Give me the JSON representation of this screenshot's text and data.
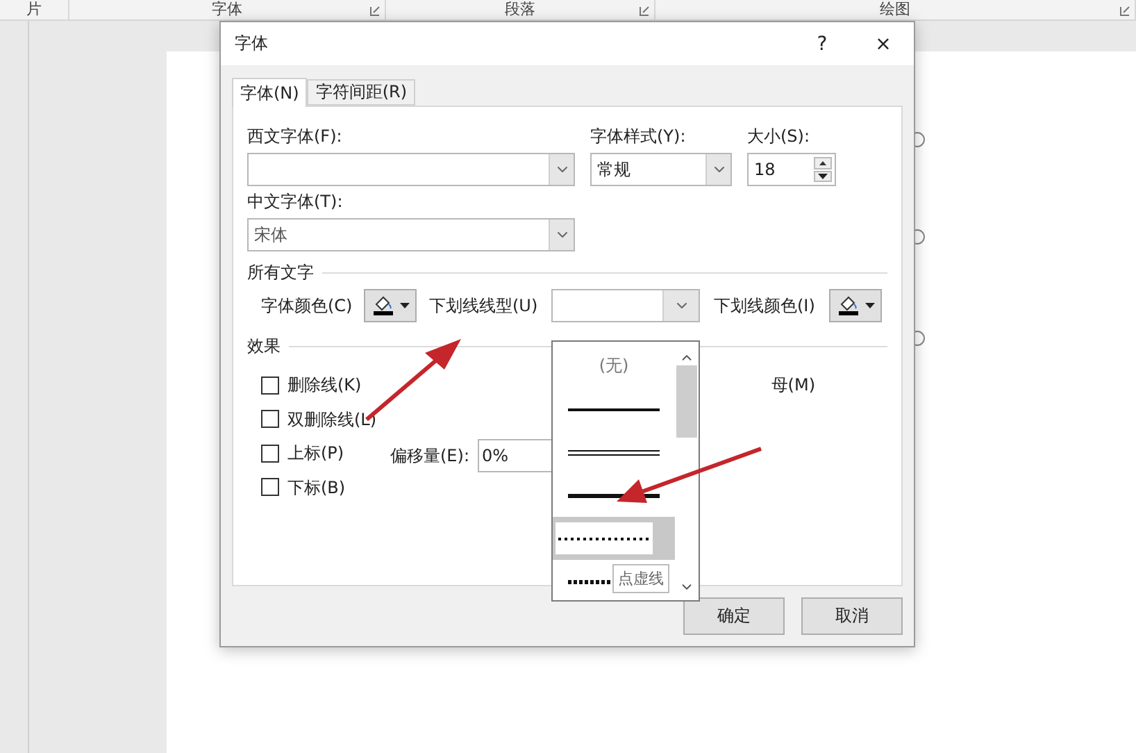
{
  "ribbon": {
    "groups": [
      {
        "label": "片",
        "launcher": false
      },
      {
        "label": "字体",
        "launcher": true
      },
      {
        "label": "段落",
        "launcher": true
      },
      {
        "label": "绘图",
        "launcher": true
      }
    ]
  },
  "dialog": {
    "title": "字体",
    "help": "?",
    "close": "×",
    "tabs": [
      {
        "label": "字体(N)",
        "selected": true
      },
      {
        "label": "字符间距(R)",
        "selected": false
      }
    ],
    "western_font": {
      "label": "西文字体(F):"
    },
    "font_style": {
      "label": "字体样式(Y):",
      "value": "常规"
    },
    "size": {
      "label": "大小(S):",
      "value": "18"
    },
    "chinese_font": {
      "label": "中文字体(T):",
      "value": "宋体"
    },
    "all_text": {
      "heading": "所有文字",
      "font_color_label": "字体颜色(C)",
      "underline_style_label": "下划线线型(U)",
      "underline_color_label": "下划线颜色(I)"
    },
    "effects": {
      "heading": "效果",
      "checkboxes": [
        {
          "label": "删除线(K)",
          "checked": false
        },
        {
          "label": "双删除线(L)",
          "checked": false
        },
        {
          "label": "上标(P)",
          "checked": false
        },
        {
          "label": "下标(B)",
          "checked": false
        }
      ],
      "right_label": "母(M)",
      "offset_label": "偏移量(E):",
      "offset_value": "0%"
    },
    "underline_list": {
      "items": [
        {
          "kind": "none",
          "label": "(无)",
          "selected": false
        },
        {
          "kind": "solid",
          "selected": false
        },
        {
          "kind": "double",
          "selected": false
        },
        {
          "kind": "thick",
          "selected": false
        },
        {
          "kind": "dotted",
          "selected": true
        },
        {
          "kind": "dotted-heavy",
          "selected": false
        }
      ],
      "tooltip": "点虚线"
    },
    "buttons": [
      "确定",
      "取消"
    ]
  }
}
